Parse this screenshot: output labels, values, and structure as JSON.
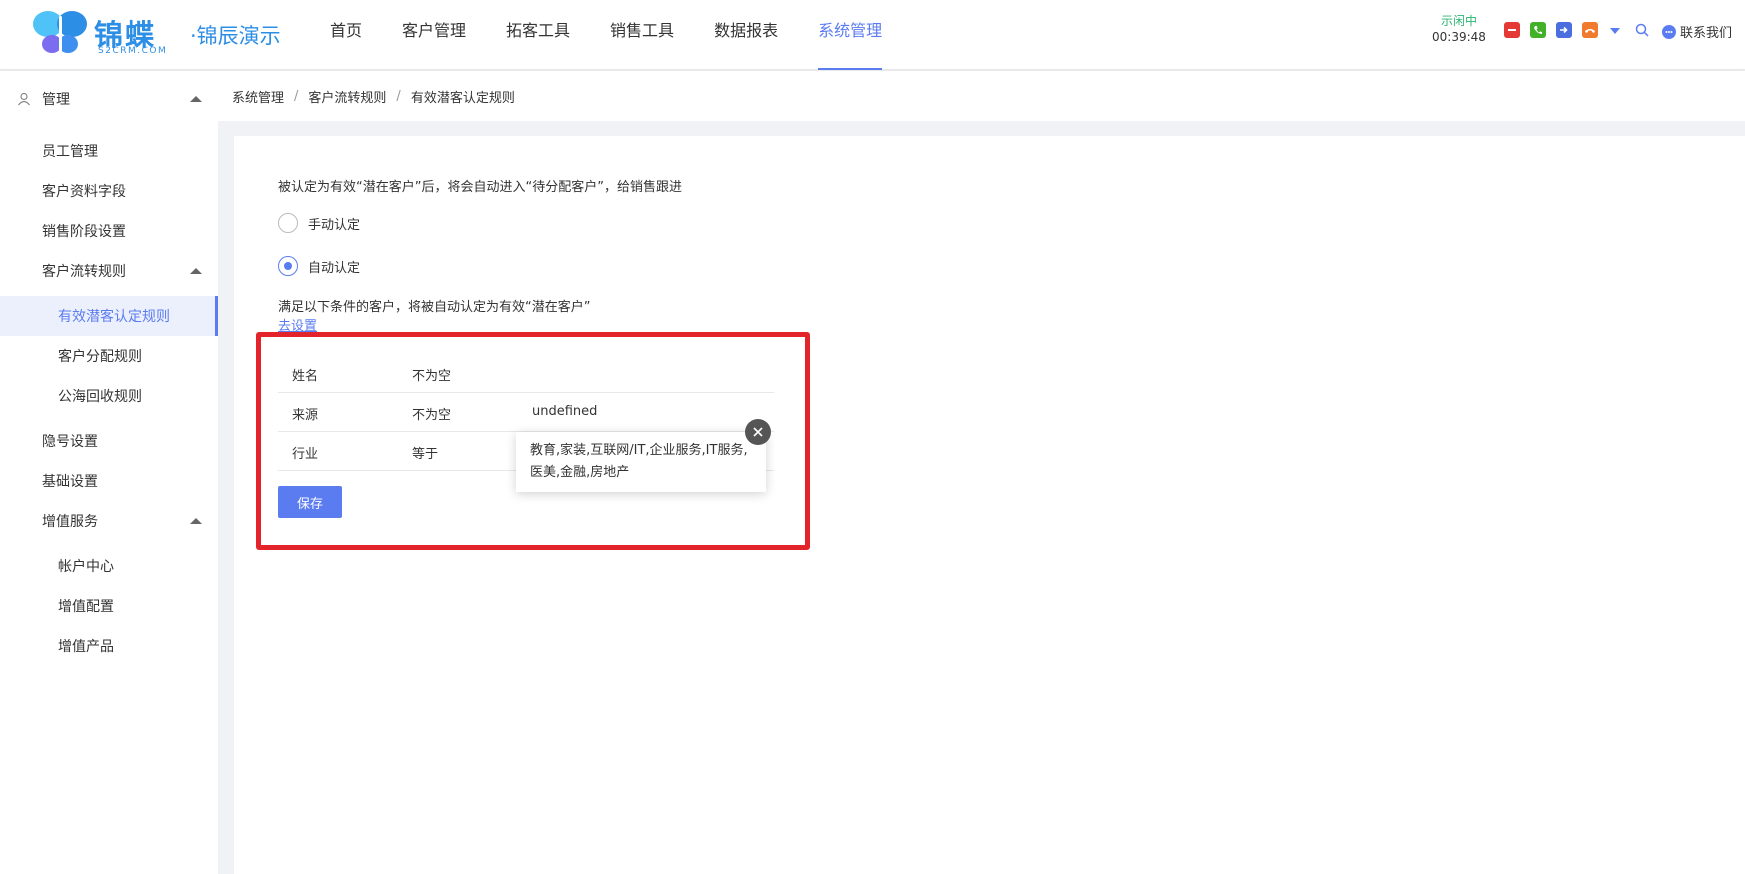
{
  "colors": {
    "accent": "#5b7cf0",
    "highlight": "#e3242b",
    "status_ok": "#2bb673"
  },
  "header": {
    "logo_name": "锦蝶",
    "logo_sub": "S2CRM.COM",
    "logo_demo": "·锦辰演示",
    "nav": [
      "首页",
      "客户管理",
      "拓客工具",
      "销售工具",
      "数据报表",
      "系统管理"
    ],
    "active_nav": "系统管理",
    "call_status": "示闲中",
    "call_timer": "00:39:48",
    "tools": [
      "busy-icon",
      "phone-icon",
      "transfer-icon",
      "hangup-icon",
      "dropdown-icon",
      "search-icon"
    ],
    "contact_label": "联系我们"
  },
  "sidebar": {
    "group_manage": "管理",
    "employee": "员工管理",
    "customer_fields": "客户资料字段",
    "sales_stage": "销售阶段设置",
    "flow_rules": "客户流转规则",
    "flow_sub": [
      "有效潜客认定规则",
      "客户分配规则",
      "公海回收规则"
    ],
    "privacy": "隐号设置",
    "basic": "基础设置",
    "value_added": "增值服务",
    "value_sub": [
      "帐户中心",
      "增值配置",
      "增值产品"
    ]
  },
  "breadcrumb": [
    "系统管理",
    "客户流转规则",
    "有效潜客认定规则"
  ],
  "main": {
    "description": "被认定为有效“潜在客户”后，将会自动进入“待分配客户”，给销售跟进",
    "radio_manual": "手动认定",
    "radio_auto": "自动认定",
    "selected_mode": "自动认定",
    "condition_desc": "满足以下条件的客户，将被自动认定为有效“潜在客户”",
    "goto_setting": "去设置",
    "rules": [
      {
        "field": "姓名",
        "op": "不为空",
        "value": ""
      },
      {
        "field": "来源",
        "op": "不为空",
        "value": "undefined"
      },
      {
        "field": "行业",
        "op": "等于",
        "value": ""
      }
    ],
    "tooltip": "教育,家装,互联网/IT,企业服务,IT服务,医美,金融,房地产",
    "save": "保存"
  }
}
